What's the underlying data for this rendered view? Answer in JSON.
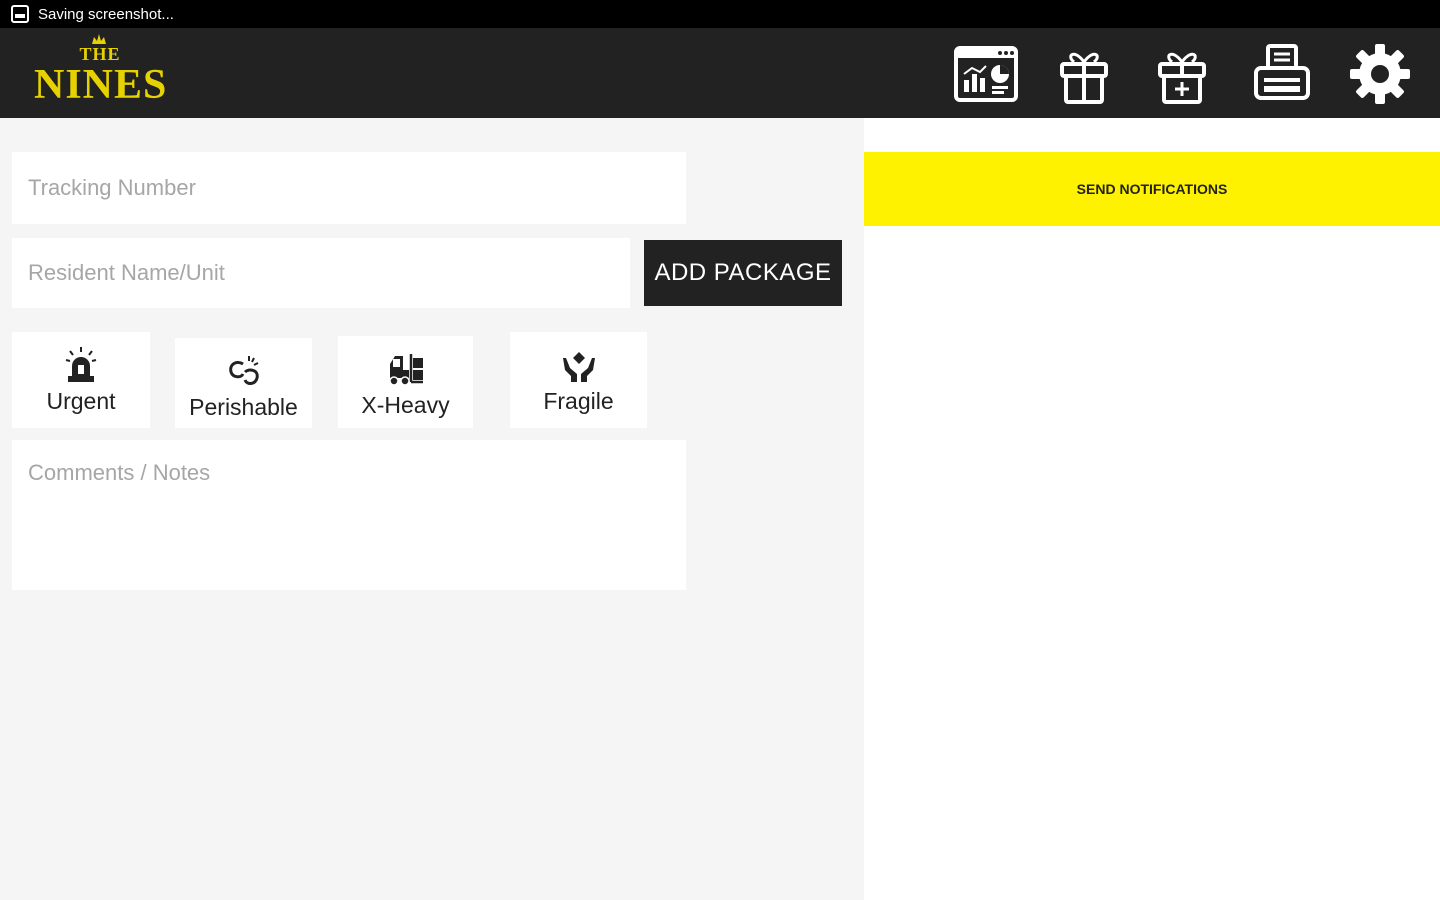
{
  "status_bar": {
    "text": "Saving screenshot..."
  },
  "header": {
    "logo_top": "THE",
    "logo_main": "NINES",
    "actions": [
      {
        "name": "dashboard-icon"
      },
      {
        "name": "gift-icon"
      },
      {
        "name": "add-gift-icon"
      },
      {
        "name": "printer-icon"
      },
      {
        "name": "gear-icon"
      }
    ]
  },
  "form": {
    "tracking_placeholder": "Tracking Number",
    "resident_placeholder": "Resident Name/Unit",
    "add_button": "ADD PACKAGE",
    "comments_placeholder": "Comments / Notes",
    "flags": [
      {
        "label": "Urgent",
        "icon": "alarm-light-icon"
      },
      {
        "label": "Perishable",
        "icon": "perishable-icon"
      },
      {
        "label": "X-Heavy",
        "icon": "forklift-icon"
      },
      {
        "label": "Fragile",
        "icon": "fragile-hands-icon"
      }
    ]
  },
  "notifications": {
    "send_label": "SEND NOTIFICATIONS"
  },
  "colors": {
    "accent": "#fff200",
    "header_bg": "#222222",
    "logo_gold": "#e6d200"
  }
}
